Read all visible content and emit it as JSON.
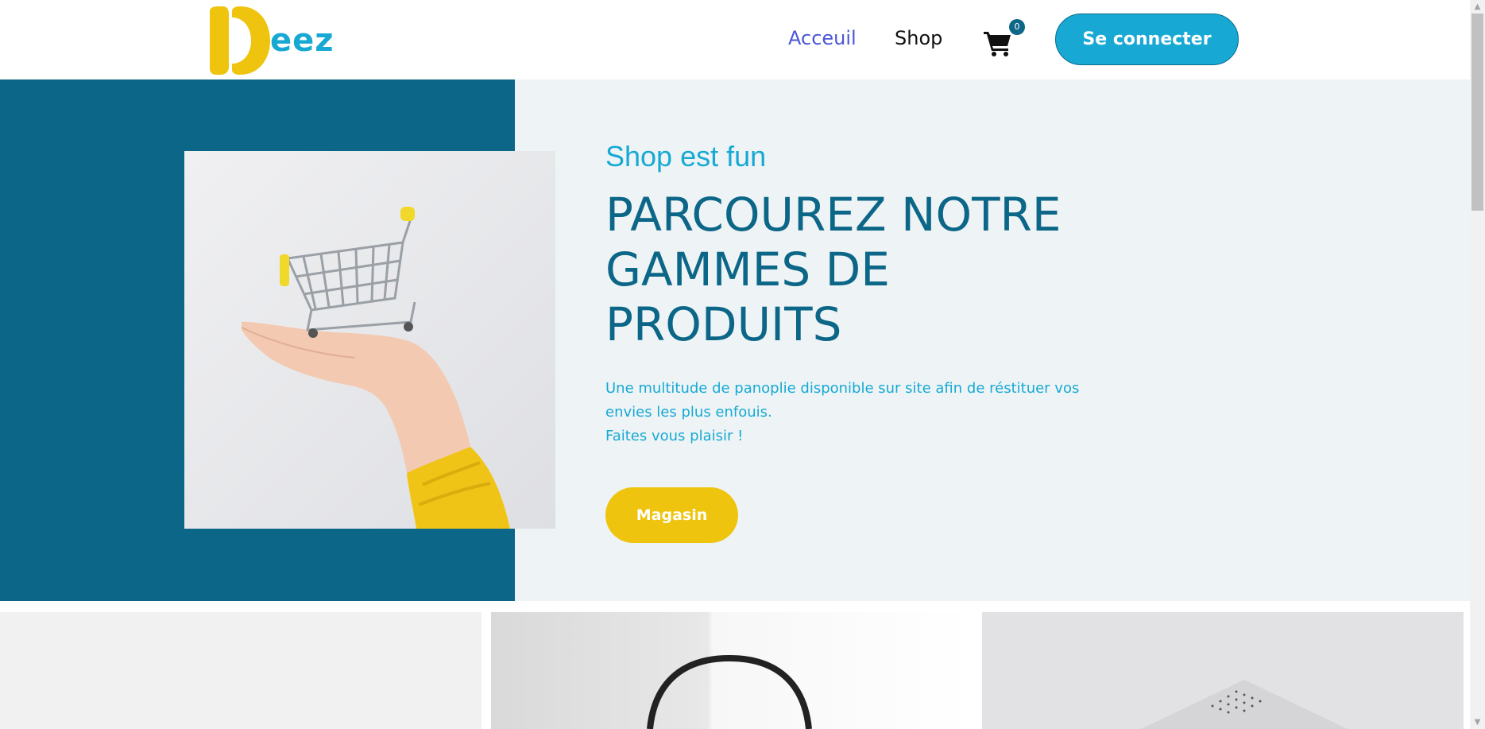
{
  "header": {
    "logo_text": "eez",
    "nav": {
      "accueil": "Acceuil",
      "shop": "Shop"
    },
    "cart_count": "0",
    "login_label": "Se connecter"
  },
  "hero": {
    "subtitle": "Shop est fun",
    "title_lines": [
      "PARCOUREZ NOTRE",
      "GAMMES DE",
      "PRODUITS"
    ],
    "description_lines": [
      "Une multitude de panoplie disponible sur site afin de réstituer vos",
      "envies les plus enfouis.",
      "Faites vous plaisir !"
    ],
    "button_label": "Magasin"
  },
  "colors": {
    "brand_blue": "#17a9d4",
    "dark_teal": "#0c6688",
    "yellow": "#eec40e",
    "nav_active": "#4a56d6"
  },
  "icons": [
    "cart-icon",
    "shopping-cart-image",
    "chevron-up-icon",
    "chevron-down-icon"
  ]
}
